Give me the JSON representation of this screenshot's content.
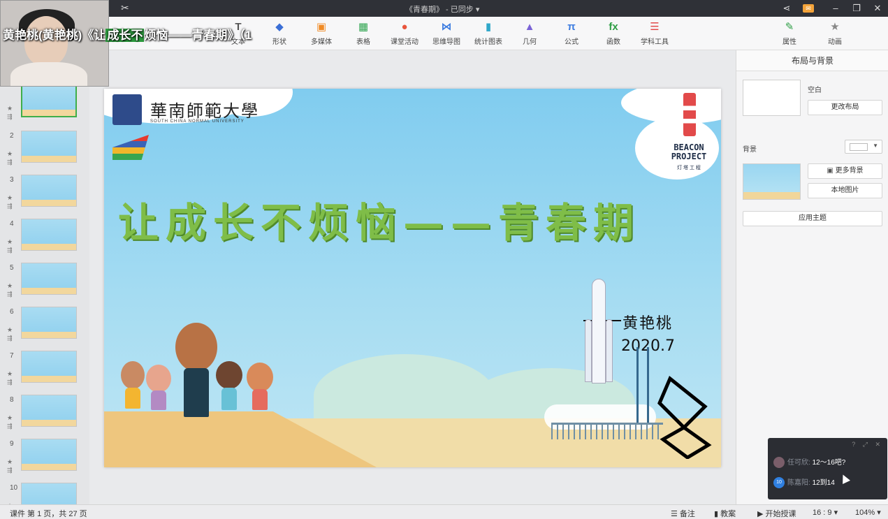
{
  "window": {
    "doc_title": "《青春期》 - 已同步 ▾"
  },
  "webcam": {
    "caption_prefix": "黄艳桃(黄艳桃)《让",
    "caption_highlight": "成长不",
    "caption_suffix": "烦恼——青春期》（",
    "caption_extra": "1"
  },
  "ribbon": {
    "items": [
      {
        "label": "文本",
        "icon": "text-icon",
        "glyph": "T",
        "color": "#555555"
      },
      {
        "label": "形状",
        "icon": "shape-icon",
        "glyph": "◆",
        "color": "#3b6fd6"
      },
      {
        "label": "多媒体",
        "icon": "media-icon",
        "glyph": "▣",
        "color": "#f08a24"
      },
      {
        "label": "表格",
        "icon": "table-icon",
        "glyph": "▦",
        "color": "#2ea44f"
      },
      {
        "label": "课堂活动",
        "icon": "classroom-activity-icon",
        "glyph": "●",
        "color": "#e8553d"
      },
      {
        "label": "思维导图",
        "icon": "mindmap-icon",
        "glyph": "⋈",
        "color": "#3b7be0"
      },
      {
        "label": "统计图表",
        "icon": "chart-icon",
        "glyph": "▮",
        "color": "#2fa7c9"
      },
      {
        "label": "几何",
        "icon": "geometry-icon",
        "glyph": "▲",
        "color": "#7a63d6"
      },
      {
        "label": "公式",
        "icon": "formula-icon",
        "glyph": "π",
        "color": "#3b7be0"
      },
      {
        "label": "函数",
        "icon": "function-icon",
        "glyph": "fx",
        "color": "#2e9e45"
      },
      {
        "label": "学科工具",
        "icon": "subject-tools-icon",
        "glyph": "☰",
        "color": "#e24a4a"
      },
      {
        "label": "属性",
        "icon": "properties-icon",
        "glyph": "✎",
        "color": "#2e9e45"
      },
      {
        "label": "动画",
        "icon": "animation-icon",
        "glyph": "★",
        "color": "#888888"
      }
    ]
  },
  "thumbnails": [
    {
      "num": "1",
      "active": true
    },
    {
      "num": "2"
    },
    {
      "num": "3"
    },
    {
      "num": "4"
    },
    {
      "num": "5"
    },
    {
      "num": "6"
    },
    {
      "num": "7"
    },
    {
      "num": "8"
    },
    {
      "num": "9"
    },
    {
      "num": "10"
    }
  ],
  "slide": {
    "university_name": "華南師範大學",
    "university_english": "SOUTH CHINA NORMAL UNIVERSITY",
    "beacon_line1": "BEACON",
    "beacon_line2": "PROJECT",
    "beacon_cn": "灯 塔 工 程",
    "title": "让成长不烦恼——青春期",
    "author": "黄艳桃",
    "date": "2020.7"
  },
  "right_panel": {
    "title": "布局与背景",
    "blank_label": "空白",
    "change_layout": "更改布局",
    "background_label": "背景",
    "more_backgrounds": "更多背景",
    "local_image": "本地图片",
    "apply_theme": "应用主题"
  },
  "chat": {
    "messages": [
      {
        "avatar_color": "#7a5e6a",
        "avatar_text": "",
        "name": "任可欣: ",
        "text": "12～16吧?"
      },
      {
        "avatar_color": "#2f7fe0",
        "avatar_text": "10",
        "name": "陈嘉阳: ",
        "text": "12到14"
      }
    ]
  },
  "statusbar": {
    "page_info": "课件 第 1 页，共 27 页",
    "notes": "备注",
    "lesson_plan": "教案",
    "start_class": "开始授课",
    "ratio": "16 : 9 ▾",
    "zoom": "104% ▾"
  }
}
